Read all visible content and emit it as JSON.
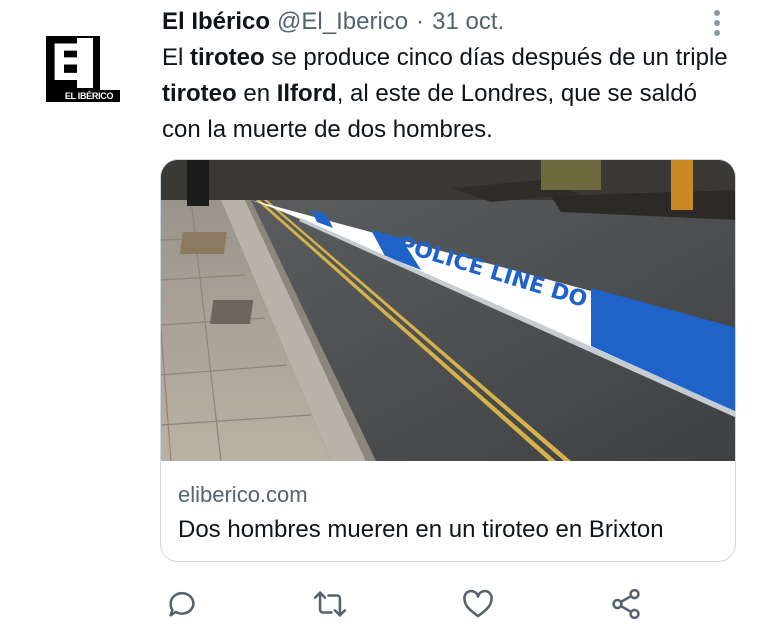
{
  "tweet": {
    "author": {
      "display_name": "El Ibérico",
      "handle": "@El_Iberico",
      "avatar_icon": "el-iberico-logo",
      "avatar_band_text": "EL IBÉRICO"
    },
    "separator": "·",
    "date": "31 oct.",
    "text_segments": [
      {
        "text": "El ",
        "bold": false
      },
      {
        "text": "tiroteo",
        "bold": true
      },
      {
        "text": " se produce cinco días después de un triple ",
        "bold": false
      },
      {
        "text": "tiroteo",
        "bold": true
      },
      {
        "text": " en ",
        "bold": false
      },
      {
        "text": "Ilford",
        "bold": true
      },
      {
        "text": ", al este de Londres, que se saldó con la muerte de dos hombres.",
        "bold": false
      }
    ],
    "card": {
      "image_tape_text": "POLICE LINE DO NOT CROSS",
      "domain": "eliberico.com",
      "title": "Dos hombres mueren en un tiroteo en Brixton"
    },
    "actions": [
      {
        "name": "reply",
        "icon": "reply-icon"
      },
      {
        "name": "retweet",
        "icon": "retweet-icon"
      },
      {
        "name": "like",
        "icon": "heart-icon"
      },
      {
        "name": "share",
        "icon": "share-icon"
      }
    ],
    "colors": {
      "text": "#0f1419",
      "secondary": "#536471",
      "border": "#cfd9de",
      "tape_blue": "#1f63c8"
    }
  }
}
